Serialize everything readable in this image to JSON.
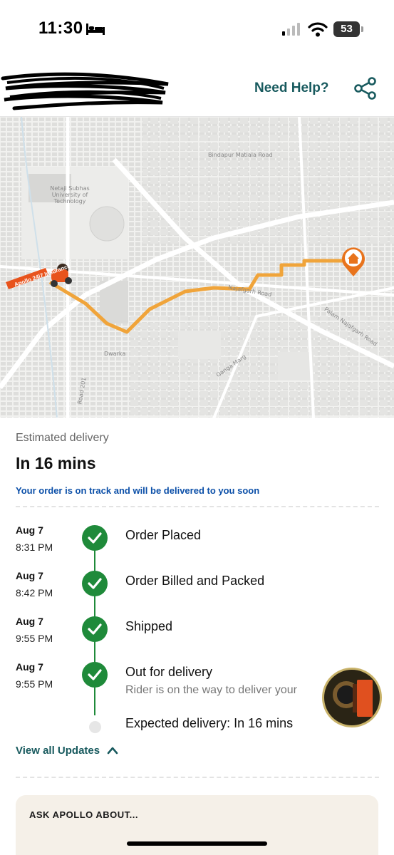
{
  "status_bar": {
    "time": "11:30",
    "battery": "53",
    "icons": [
      "bed-icon",
      "signal-icon",
      "wifi-icon",
      "battery-icon"
    ]
  },
  "header": {
    "help_label": "Need Help?",
    "share_icon": "share-icon",
    "accent_color": "#185a5e"
  },
  "map": {
    "labels": {
      "university": "Netaji Subhas University of Technology",
      "road_top": "Bindapur Matiala Road",
      "area": "Dwarka",
      "road_right": "Palam Najafgarh Road",
      "road_diag": "Najafgarh Road",
      "road_bottom": "Road 201",
      "road_ganga": "Ganga Marg"
    },
    "rider_badge": "Apollo 24|7 Insurance",
    "destination_icon": "home-icon",
    "route_color": "#f0a43a"
  },
  "eta": {
    "label": "Estimated delivery",
    "value": "In 16 mins",
    "note": "Your order is on track and will be delivered to you soon"
  },
  "timeline": [
    {
      "date": "Aug 7",
      "time": "8:31 PM",
      "title": "Order Placed",
      "subtitle": ""
    },
    {
      "date": "Aug 7",
      "time": "8:42 PM",
      "title": "Order Billed and Packed",
      "subtitle": ""
    },
    {
      "date": "Aug 7",
      "time": "9:55 PM",
      "title": "Shipped",
      "subtitle": ""
    },
    {
      "date": "Aug 7",
      "time": "9:55 PM",
      "title": "Out for delivery",
      "subtitle": "Rider is on the way to deliver your"
    }
  ],
  "expected": "Expected delivery: In 16 mins",
  "view_all_label": "View all Updates",
  "ask_card": {
    "title": "ASK APOLLO ABOUT..."
  },
  "colors": {
    "success": "#1f8a3a",
    "link_blue": "#0b4fa8",
    "card_bg": "#f5f0e8"
  }
}
